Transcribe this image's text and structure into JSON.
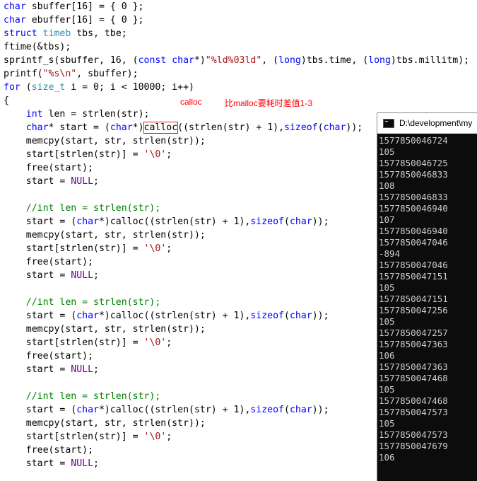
{
  "code": {
    "lines": [
      {
        "segments": [
          {
            "t": "char",
            "c": "kw"
          },
          {
            "t": " sbuffer[16] = { 0 };",
            "c": ""
          }
        ]
      },
      {
        "segments": [
          {
            "t": "char",
            "c": "kw"
          },
          {
            "t": " ebuffer[16] = { 0 };",
            "c": ""
          }
        ]
      },
      {
        "segments": [
          {
            "t": "struct",
            "c": "kw"
          },
          {
            "t": " ",
            "c": ""
          },
          {
            "t": "timeb",
            "c": "ty"
          },
          {
            "t": " tbs, tbe;",
            "c": ""
          }
        ]
      },
      {
        "segments": [
          {
            "t": "ftime(&tbs);",
            "c": ""
          }
        ]
      },
      {
        "segments": [
          {
            "t": "sprintf_s(sbuffer, 16, (",
            "c": ""
          },
          {
            "t": "const",
            "c": "kw"
          },
          {
            "t": " ",
            "c": ""
          },
          {
            "t": "char",
            "c": "kw"
          },
          {
            "t": "*)",
            "c": ""
          },
          {
            "t": "\"%ld%03ld\"",
            "c": "str"
          },
          {
            "t": ", (",
            "c": ""
          },
          {
            "t": "long",
            "c": "kw"
          },
          {
            "t": ")tbs.time, (",
            "c": ""
          },
          {
            "t": "long",
            "c": "kw"
          },
          {
            "t": ")tbs.millitm);",
            "c": ""
          }
        ]
      },
      {
        "segments": [
          {
            "t": "printf(",
            "c": ""
          },
          {
            "t": "\"%s\\n\"",
            "c": "str"
          },
          {
            "t": ", sbuffer);",
            "c": ""
          }
        ]
      },
      {
        "segments": [
          {
            "t": "for",
            "c": "kw"
          },
          {
            "t": " (",
            "c": ""
          },
          {
            "t": "size_t",
            "c": "ty"
          },
          {
            "t": " i = 0; i < 10000; i++)",
            "c": ""
          }
        ]
      },
      {
        "segments": [
          {
            "t": "{",
            "c": ""
          }
        ]
      },
      {
        "segments": [
          {
            "t": "    ",
            "c": ""
          },
          {
            "t": "int",
            "c": "kw"
          },
          {
            "t": " len = strlen(str);",
            "c": ""
          }
        ]
      },
      {
        "segments": [
          {
            "t": "    ",
            "c": ""
          },
          {
            "t": "char",
            "c": "kw"
          },
          {
            "t": "* start = (",
            "c": ""
          },
          {
            "t": "char",
            "c": "kw"
          },
          {
            "t": "*)",
            "c": ""
          },
          {
            "t": "calloc",
            "c": "hl"
          },
          {
            "t": "((strlen(str) + 1),",
            "c": ""
          },
          {
            "t": "sizeof",
            "c": "kw"
          },
          {
            "t": "(",
            "c": ""
          },
          {
            "t": "char",
            "c": "kw"
          },
          {
            "t": "));",
            "c": ""
          }
        ]
      },
      {
        "segments": [
          {
            "t": "    memcpy(start, str, strlen(str));",
            "c": ""
          }
        ]
      },
      {
        "segments": [
          {
            "t": "    start[strlen(str)] = ",
            "c": ""
          },
          {
            "t": "'\\0'",
            "c": "str"
          },
          {
            "t": ";",
            "c": ""
          }
        ]
      },
      {
        "segments": [
          {
            "t": "    free(start);",
            "c": ""
          }
        ]
      },
      {
        "segments": [
          {
            "t": "    start = ",
            "c": ""
          },
          {
            "t": "NULL",
            "c": "mac"
          },
          {
            "t": ";",
            "c": ""
          }
        ]
      },
      {
        "segments": [
          {
            "t": "",
            "c": ""
          }
        ]
      },
      {
        "segments": [
          {
            "t": "    ",
            "c": ""
          },
          {
            "t": "//int len = strlen(str);",
            "c": "cmt"
          }
        ]
      },
      {
        "segments": [
          {
            "t": "    start = (",
            "c": ""
          },
          {
            "t": "char",
            "c": "kw"
          },
          {
            "t": "*)calloc((strlen(str) + 1),",
            "c": ""
          },
          {
            "t": "sizeof",
            "c": "kw"
          },
          {
            "t": "(",
            "c": ""
          },
          {
            "t": "char",
            "c": "kw"
          },
          {
            "t": "));",
            "c": ""
          }
        ]
      },
      {
        "segments": [
          {
            "t": "    memcpy(start, str, strlen(str));",
            "c": ""
          }
        ]
      },
      {
        "segments": [
          {
            "t": "    start[strlen(str)] = ",
            "c": ""
          },
          {
            "t": "'\\0'",
            "c": "str"
          },
          {
            "t": ";",
            "c": ""
          }
        ]
      },
      {
        "segments": [
          {
            "t": "    free(start);",
            "c": ""
          }
        ]
      },
      {
        "segments": [
          {
            "t": "    start = ",
            "c": ""
          },
          {
            "t": "NULL",
            "c": "mac"
          },
          {
            "t": ";",
            "c": ""
          }
        ]
      },
      {
        "segments": [
          {
            "t": "",
            "c": ""
          }
        ]
      },
      {
        "segments": [
          {
            "t": "    ",
            "c": ""
          },
          {
            "t": "//int len = strlen(str);",
            "c": "cmt"
          }
        ]
      },
      {
        "segments": [
          {
            "t": "    start = (",
            "c": ""
          },
          {
            "t": "char",
            "c": "kw"
          },
          {
            "t": "*)calloc((strlen(str) + 1),",
            "c": ""
          },
          {
            "t": "sizeof",
            "c": "kw"
          },
          {
            "t": "(",
            "c": ""
          },
          {
            "t": "char",
            "c": "kw"
          },
          {
            "t": "));",
            "c": ""
          }
        ]
      },
      {
        "segments": [
          {
            "t": "    memcpy(start, str, strlen(str));",
            "c": ""
          }
        ]
      },
      {
        "segments": [
          {
            "t": "    start[strlen(str)] = ",
            "c": ""
          },
          {
            "t": "'\\0'",
            "c": "str"
          },
          {
            "t": ";",
            "c": ""
          }
        ]
      },
      {
        "segments": [
          {
            "t": "    free(start);",
            "c": ""
          }
        ]
      },
      {
        "segments": [
          {
            "t": "    start = ",
            "c": ""
          },
          {
            "t": "NULL",
            "c": "mac"
          },
          {
            "t": ";",
            "c": ""
          }
        ]
      },
      {
        "segments": [
          {
            "t": "",
            "c": ""
          }
        ]
      },
      {
        "segments": [
          {
            "t": "    ",
            "c": ""
          },
          {
            "t": "//int len = strlen(str);",
            "c": "cmt"
          }
        ]
      },
      {
        "segments": [
          {
            "t": "    start = (",
            "c": ""
          },
          {
            "t": "char",
            "c": "kw"
          },
          {
            "t": "*)calloc((strlen(str) + 1),",
            "c": ""
          },
          {
            "t": "sizeof",
            "c": "kw"
          },
          {
            "t": "(",
            "c": ""
          },
          {
            "t": "char",
            "c": "kw"
          },
          {
            "t": "));",
            "c": ""
          }
        ]
      },
      {
        "segments": [
          {
            "t": "    memcpy(start, str, strlen(str));",
            "c": ""
          }
        ]
      },
      {
        "segments": [
          {
            "t": "    start[strlen(str)] = ",
            "c": ""
          },
          {
            "t": "'\\0'",
            "c": "str"
          },
          {
            "t": ";",
            "c": ""
          }
        ]
      },
      {
        "segments": [
          {
            "t": "    free(start);",
            "c": ""
          }
        ]
      },
      {
        "segments": [
          {
            "t": "    start = ",
            "c": ""
          },
          {
            "t": "NULL",
            "c": "mac"
          },
          {
            "t": ";",
            "c": ""
          }
        ]
      }
    ]
  },
  "annotations": {
    "calloc_label": "calloc",
    "comparison_note": "比malloc要耗时差值1-3"
  },
  "console": {
    "title": "D:\\development\\my",
    "icon": "console-window-icon",
    "output": [
      "1577850046724",
      "105",
      "1577850046725",
      "1577850046833",
      "108",
      "1577850046833",
      "1577850046940",
      "107",
      "1577850046940",
      "1577850047046",
      "-894",
      "1577850047046",
      "1577850047151",
      "105",
      "1577850047151",
      "1577850047256",
      "105",
      "1577850047257",
      "1577850047363",
      "106",
      "1577850047363",
      "1577850047468",
      "105",
      "1577850047468",
      "1577850047573",
      "105",
      "1577850047573",
      "1577850047679",
      "106"
    ]
  },
  "colors": {
    "keyword": "#0000ff",
    "type": "#2b91af",
    "string": "#a31515",
    "comment": "#008000",
    "macro": "#6f008a",
    "annotation": "#ff0000",
    "console_bg": "#0c0c0c",
    "console_text": "#cccccc"
  }
}
